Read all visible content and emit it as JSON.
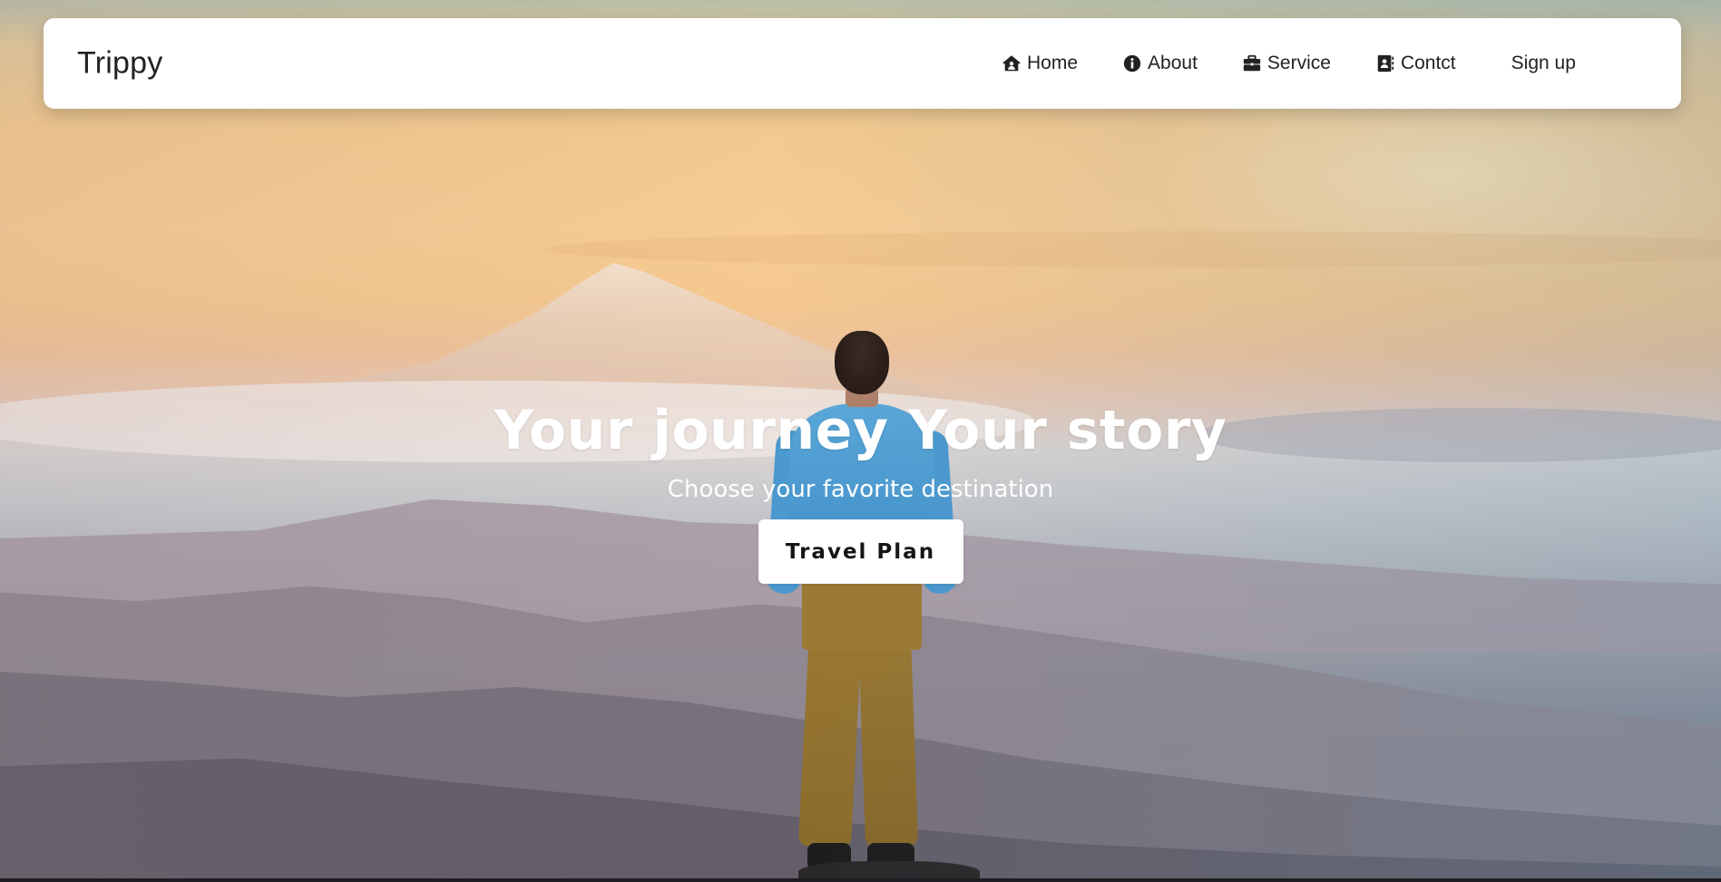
{
  "navbar": {
    "brand": "Trippy",
    "items": [
      {
        "label": "Home",
        "icon": "house-user-icon"
      },
      {
        "label": "About",
        "icon": "info-circle-icon"
      },
      {
        "label": "Service",
        "icon": "briefcase-icon"
      },
      {
        "label": "Contct",
        "icon": "address-book-icon"
      }
    ],
    "signup_label": "Sign up"
  },
  "hero": {
    "title": "Your journey Your story",
    "subtitle": "Choose your favorite destination",
    "cta_label": "Travel Plan",
    "background_image": "man-on-mountain-at-sunrise"
  },
  "colors": {
    "navbar_bg": "#ffffff",
    "text_dark": "#222222",
    "hero_text": "#ffffff",
    "cta_bg": "#ffffff"
  }
}
